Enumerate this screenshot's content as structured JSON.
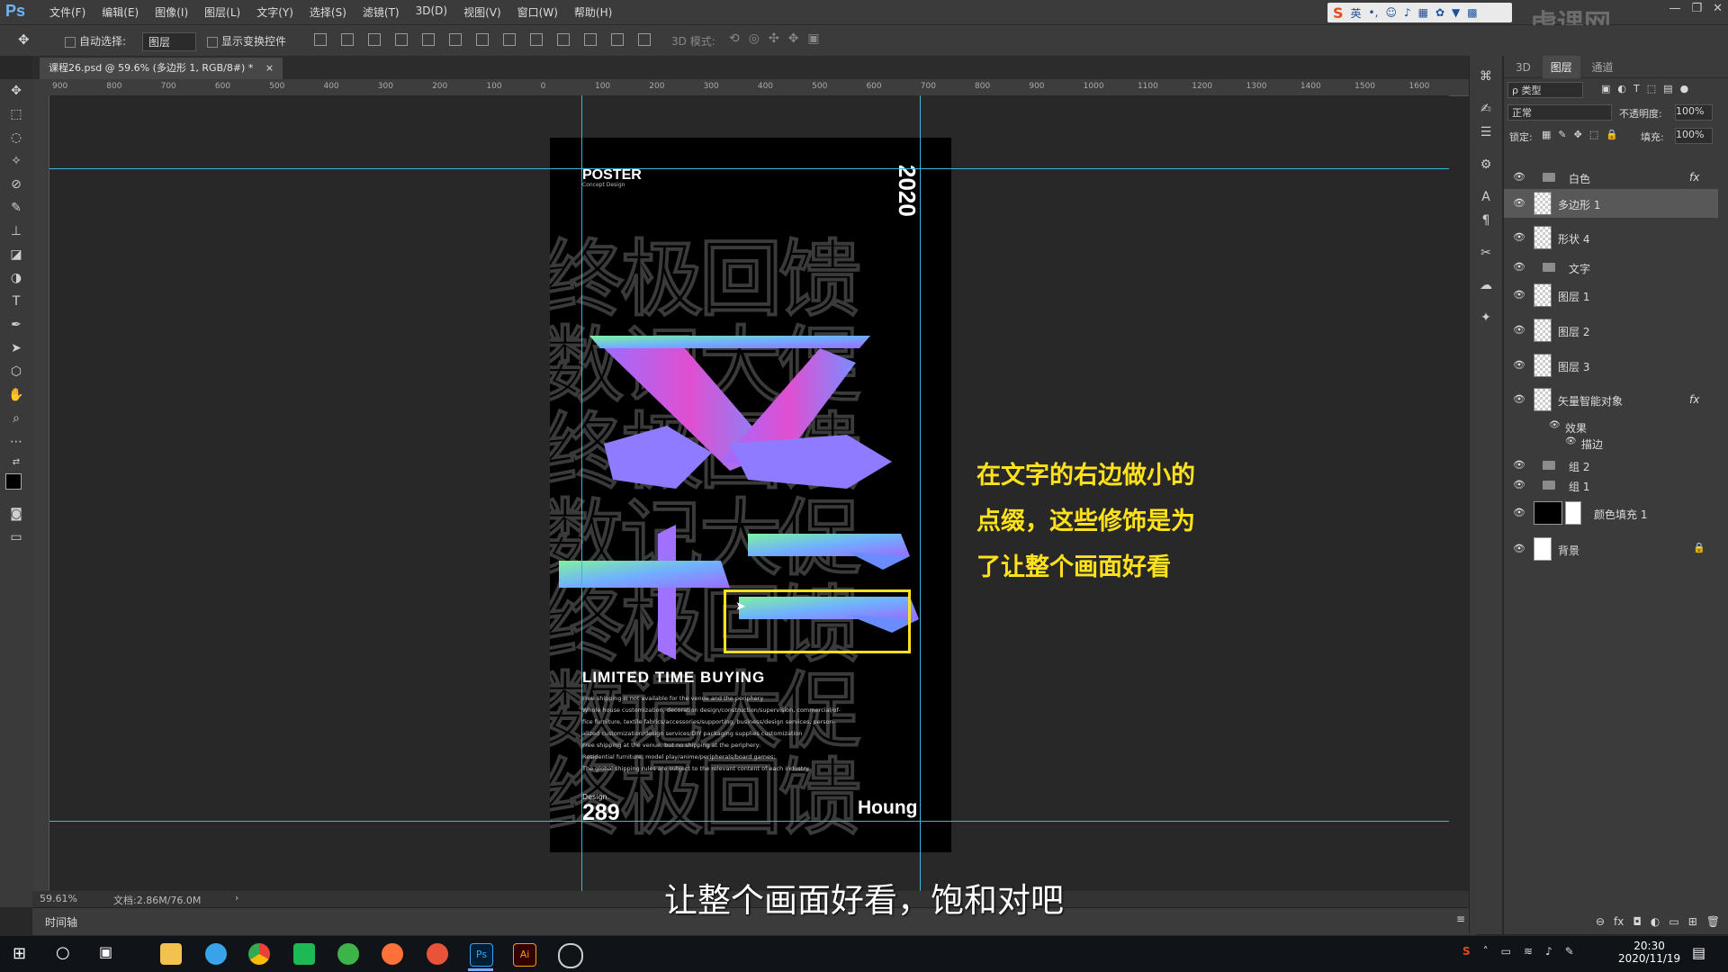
{
  "app": {
    "logo": "Ps",
    "menu": [
      "文件(F)",
      "编辑(E)",
      "图像(I)",
      "图层(L)",
      "文字(Y)",
      "选择(S)",
      "滤镜(T)",
      "3D(D)",
      "视图(V)",
      "窗口(W)",
      "帮助(H)"
    ],
    "window_controls": [
      "—",
      "❐",
      "✕"
    ]
  },
  "options_bar": {
    "auto_select_label": "自动选择:",
    "auto_select_value": "图层",
    "show_transform_label": "显示变换控件",
    "mode_3d_label": "3D 模式:"
  },
  "document": {
    "tab_title": "课程26.psd @ 59.6% (多边形 1, RGB/8#) *",
    "close_glyph": "×",
    "ruler_labels": [
      "900",
      "800",
      "700",
      "600",
      "500",
      "400",
      "300",
      "200",
      "100",
      "0",
      "100",
      "200",
      "300",
      "400",
      "500",
      "600",
      "700",
      "800",
      "900",
      "1000",
      "1100",
      "1200",
      "1300",
      "1400",
      "1500",
      "1600"
    ]
  },
  "poster": {
    "header": "POSTER",
    "header_sub": "Concept Design",
    "year": "2020",
    "big_char_top": "文",
    "big_char_bottom": "长",
    "headline": "LIMITED TIME BUYING",
    "body_lines": [
      "Free shipping is not available for the venue and the periphery",
      "Whole house customization, decoration design/construction/supervision, commercial/of-",
      "fice furniture, textile fabrics/accessories/supporting, business/design services, person-",
      "alized customization/design services/DIY packaging supplies customization",
      "Free shipping at the venue, but no shipping at the periphery:",
      "Residential furniture, model play/anime/peripherals/board games;",
      "The global shipping rules are subject to the relevant content of each industry."
    ],
    "design_label": "Design.",
    "number": "289",
    "brand": "Houng"
  },
  "status_bar": {
    "zoom": "59.61%",
    "doc_info": "文档:2.86M/76.0M",
    "arrow": "›"
  },
  "timeline_label": "时间轴",
  "layers_panel": {
    "tabs": [
      "3D",
      "图层",
      "通道"
    ],
    "active_tab": "图层",
    "filter_label": "ρ 类型",
    "blend_mode": "正常",
    "opacity_label": "不透明度:",
    "opacity_value": "100%",
    "lock_label": "锁定:",
    "fill_label": "填充:",
    "fill_value": "100%",
    "layers": [
      {
        "name": "白色",
        "kind": "group",
        "fx": true
      },
      {
        "name": "多边形 1",
        "kind": "layer",
        "selected": true
      },
      {
        "name": "形状 4",
        "kind": "layer"
      },
      {
        "name": "文字",
        "kind": "group"
      },
      {
        "name": "图层 1",
        "kind": "layer"
      },
      {
        "name": "图层 2",
        "kind": "layer"
      },
      {
        "name": "图层 3",
        "kind": "layer"
      },
      {
        "name": "矢量智能对象",
        "kind": "smart",
        "fx": true
      },
      {
        "name": "效果",
        "kind": "effect"
      },
      {
        "name": "描边",
        "kind": "effect-item"
      },
      {
        "name": "组 2",
        "kind": "group"
      },
      {
        "name": "组 1",
        "kind": "group"
      },
      {
        "name": "颜色填充 1",
        "kind": "fill"
      },
      {
        "name": "背景",
        "kind": "background"
      }
    ],
    "fx_label": "fx"
  },
  "annotation": {
    "lines": [
      "在文字的右边做小的",
      "点缀，这些修饰是为",
      "了让整个画面好看"
    ],
    "color": "#ffe21c"
  },
  "subtitle": "让整个画面好看，饱和对吧",
  "ime_bar": {
    "lang": "英"
  },
  "watermark": "虎课网",
  "taskbar": {
    "time": "20:30",
    "date": "2020/11/19",
    "apps": [
      "file-explorer",
      "browser-q",
      "chrome",
      "iqiyi",
      "360",
      "firefox",
      "g-app",
      "photoshop",
      "illustrator",
      "clock-app"
    ]
  },
  "colors": {
    "guide": "#39b8d8",
    "highlight_box": "#ffe21c",
    "ui_bg": "#3b3b3b"
  }
}
